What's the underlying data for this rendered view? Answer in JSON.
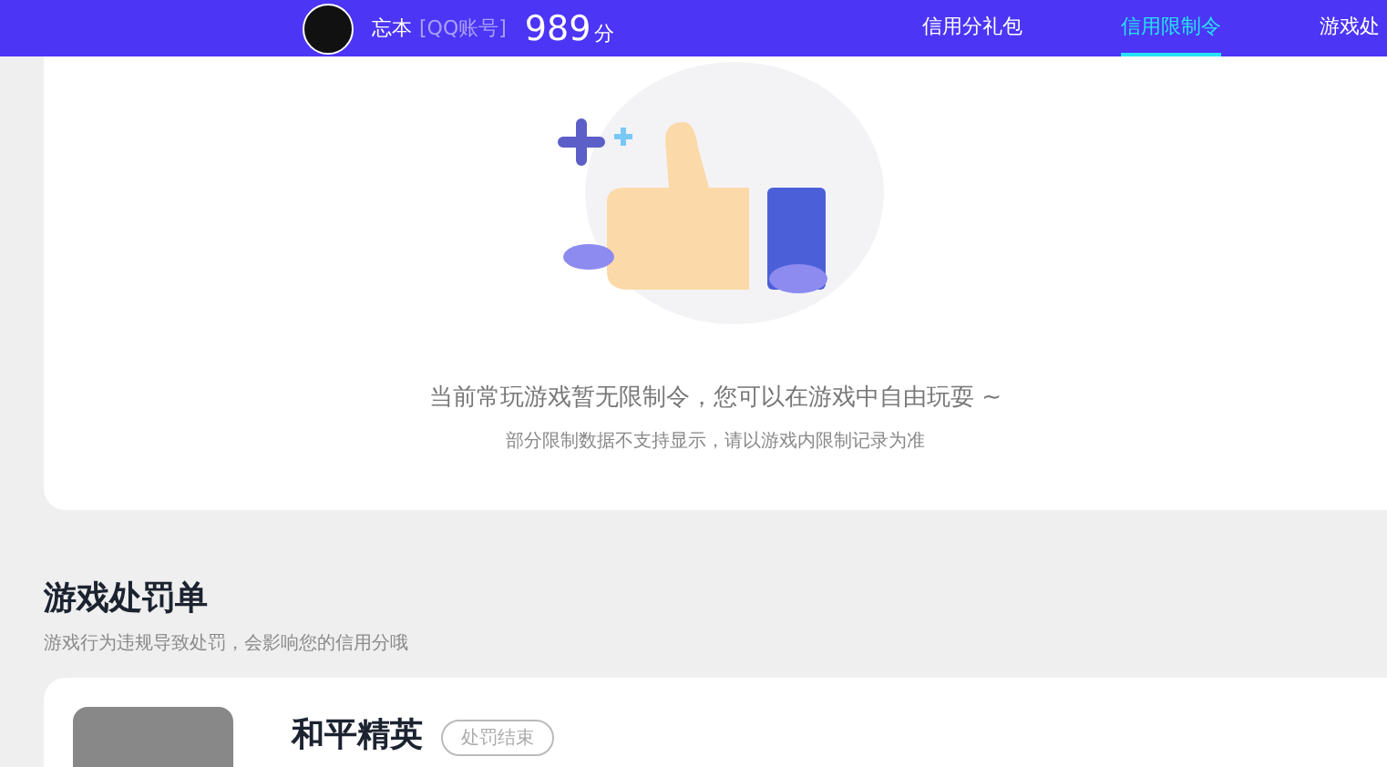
{
  "header": {
    "user_name": "忘本",
    "account_type": "[QQ账号]",
    "score": "989",
    "score_unit": "分",
    "tabs": [
      {
        "label": "信用分礼包",
        "selected": false
      },
      {
        "label": "信用限制令",
        "selected": true
      },
      {
        "label": "游戏处",
        "selected": false
      }
    ]
  },
  "restriction_card": {
    "message": "当前常玩游戏暂无限制令，您可以在游戏中自由玩耍 ~",
    "note": "部分限制数据不支持显示，请以游戏内限制记录为准"
  },
  "penalty_section": {
    "title": "游戏处罚单",
    "subtitle": "游戏行为违规导致处罚，会影响您的信用分哦",
    "items": [
      {
        "game": "和平精英",
        "status": "处罚结束"
      }
    ]
  }
}
